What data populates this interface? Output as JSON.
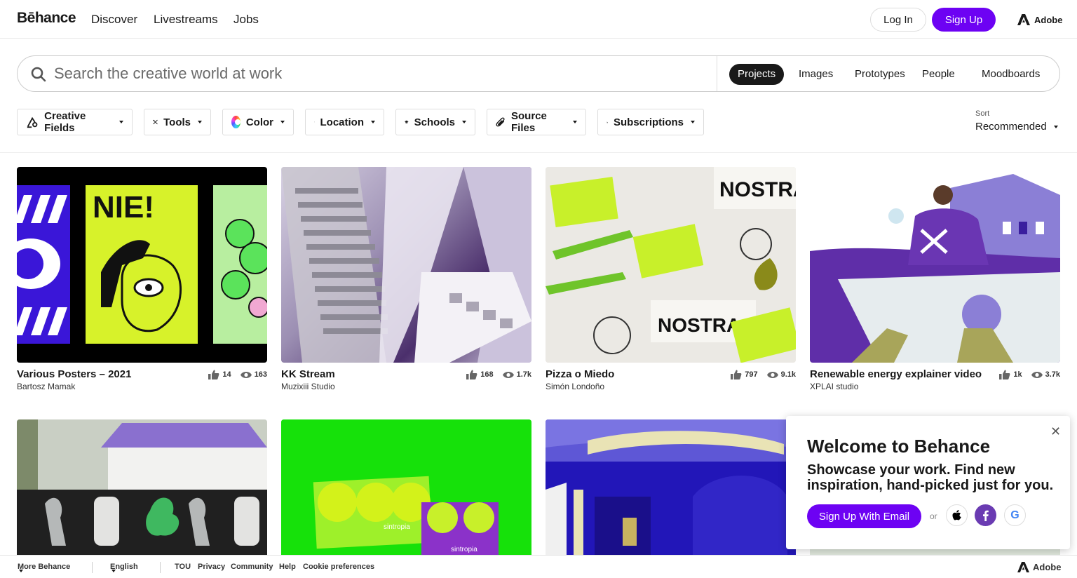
{
  "header": {
    "logo": "Bēhance",
    "nav": [
      "Discover",
      "Livestreams",
      "Jobs"
    ],
    "login_label": "Log In",
    "signup_label": "Sign Up",
    "adobe_label": "Adobe"
  },
  "search": {
    "placeholder": "Search the creative world at work",
    "tabs": [
      "Projects",
      "Images",
      "Prototypes",
      "People",
      "Moodboards"
    ],
    "active_tab": "Projects"
  },
  "filters": [
    "Creative Fields",
    "Tools",
    "Color",
    "Location",
    "Schools",
    "Source Files",
    "Subscriptions"
  ],
  "sort": {
    "label": "Sort",
    "value": "Recommended"
  },
  "projects": [
    {
      "title": "Various Posters – 2021",
      "author": "Bartosz Mamak",
      "likes": "14",
      "views": "163"
    },
    {
      "title": "KK Stream",
      "author": "Muzixiii Studio",
      "likes": "168",
      "views": "1.7k"
    },
    {
      "title": "Pizza o Miedo",
      "author": "Simón Londoño",
      "likes": "797",
      "views": "9.1k"
    },
    {
      "title": "Renewable energy explainer video",
      "author": "XPLAI studio",
      "likes": "1k",
      "views": "3.7k"
    }
  ],
  "thumb_text": {
    "nie": "NIE!",
    "nostra": "NOSTRA",
    "sintropia": "sintropia"
  },
  "welcome": {
    "title": "Welcome to Behance",
    "body": "Showcase your work. Find new inspiration, hand-picked just for you.",
    "signup_email": "Sign Up With Email",
    "or": "or"
  },
  "footer": {
    "more": "More Behance",
    "language": "English",
    "links": [
      "TOU",
      "Privacy",
      "Community",
      "Help",
      "Cookie preferences"
    ],
    "adobe": "Adobe"
  },
  "colors": {
    "brand": "#6d02f3",
    "text": "#191919"
  }
}
